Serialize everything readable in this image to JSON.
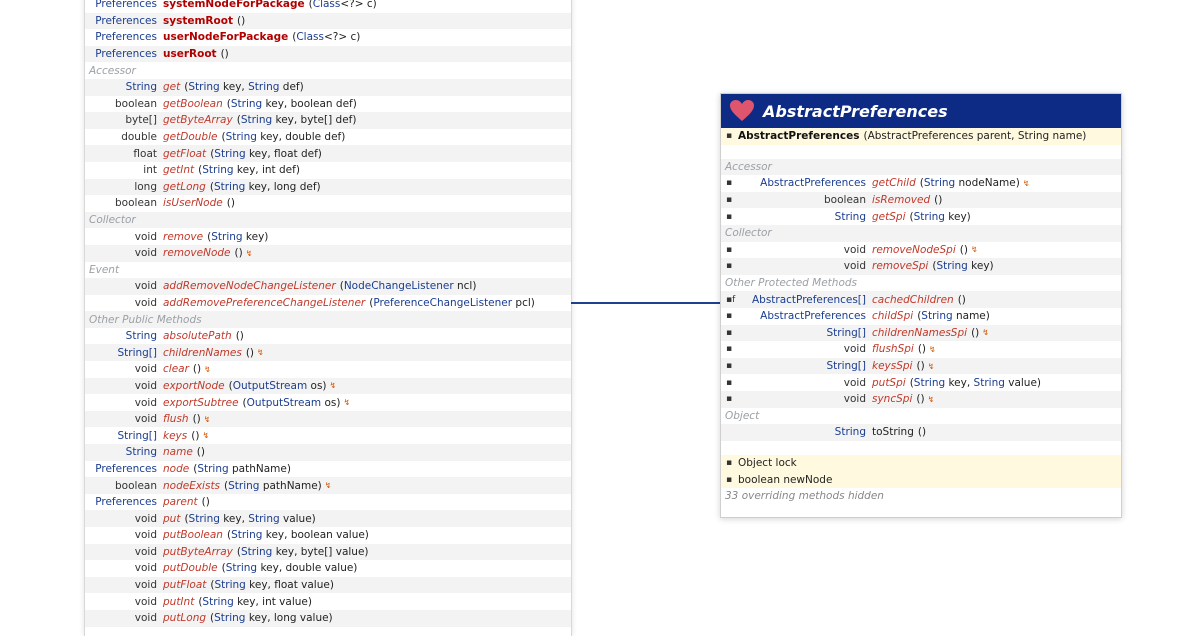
{
  "left_rows": [
    {
      "type": "Preferences",
      "name": "systemNodeForPackage",
      "style": "static",
      "params": [
        [
          "t",
          "Class"
        ],
        [
          "p",
          "<?> c)"
        ]
      ],
      "open": "("
    },
    {
      "type": "Preferences",
      "name": "systemRoot",
      "style": "static",
      "params": [
        [
          "p",
          "()"
        ]
      ]
    },
    {
      "type": "Preferences",
      "name": "userNodeForPackage",
      "style": "static",
      "params": [
        [
          "t",
          "Class"
        ],
        [
          "p",
          "<?> c)"
        ]
      ],
      "open": "("
    },
    {
      "type": "Preferences",
      "name": "userRoot",
      "style": "static",
      "params": [
        [
          "p",
          "()"
        ]
      ]
    },
    {
      "cat": "Accessor"
    },
    {
      "type": "String",
      "name": "get",
      "params": [
        [
          "t",
          "String"
        ],
        [
          "p",
          "key, "
        ],
        [
          "t",
          "String"
        ],
        [
          "p",
          "def)"
        ]
      ],
      "open": "("
    },
    {
      "type": "boolean",
      "prim": true,
      "name": "getBoolean",
      "params": [
        [
          "t",
          "String"
        ],
        [
          "p",
          "key, boolean def)"
        ]
      ],
      "open": "("
    },
    {
      "type": "byte[]",
      "prim": true,
      "name": "getByteArray",
      "params": [
        [
          "t",
          "String"
        ],
        [
          "p",
          "key, byte[] def)"
        ]
      ],
      "open": "("
    },
    {
      "type": "double",
      "prim": true,
      "name": "getDouble",
      "params": [
        [
          "t",
          "String"
        ],
        [
          "p",
          "key, double def)"
        ]
      ],
      "open": "("
    },
    {
      "type": "float",
      "prim": true,
      "name": "getFloat",
      "params": [
        [
          "t",
          "String"
        ],
        [
          "p",
          "key, float def)"
        ]
      ],
      "open": "("
    },
    {
      "type": "int",
      "prim": true,
      "name": "getInt",
      "params": [
        [
          "t",
          "String"
        ],
        [
          "p",
          "key, int def)"
        ]
      ],
      "open": "("
    },
    {
      "type": "long",
      "prim": true,
      "name": "getLong",
      "params": [
        [
          "t",
          "String"
        ],
        [
          "p",
          "key, long def)"
        ]
      ],
      "open": "("
    },
    {
      "type": "boolean",
      "prim": true,
      "name": "isUserNode",
      "params": [
        [
          "p",
          "()"
        ]
      ]
    },
    {
      "cat": "Collector"
    },
    {
      "type": "void",
      "prim": true,
      "name": "remove",
      "params": [
        [
          "t",
          "String"
        ],
        [
          "p",
          "key)"
        ]
      ],
      "open": "("
    },
    {
      "type": "void",
      "prim": true,
      "name": "removeNode",
      "params": [
        [
          "p",
          "()"
        ]
      ],
      "ind": "↯"
    },
    {
      "cat": "Event"
    },
    {
      "type": "void",
      "prim": true,
      "name": "addRemoveNodeChangeListener",
      "params": [
        [
          "t",
          "NodeChangeListener"
        ],
        [
          "p",
          "ncl)"
        ]
      ],
      "open": "("
    },
    {
      "type": "void",
      "prim": true,
      "name": "addRemovePreferenceChangeListener",
      "params": [
        [
          "t",
          "PreferenceChangeListener"
        ],
        [
          "p",
          "pcl)"
        ]
      ],
      "open": "("
    },
    {
      "cat": "Other Public Methods"
    },
    {
      "type": "String",
      "name": "absolutePath",
      "params": [
        [
          "p",
          "()"
        ]
      ]
    },
    {
      "type": "String[]",
      "name": "childrenNames",
      "params": [
        [
          "p",
          "()"
        ]
      ],
      "ind": "↯"
    },
    {
      "type": "void",
      "prim": true,
      "name": "clear",
      "params": [
        [
          "p",
          "()"
        ]
      ],
      "ind": "↯"
    },
    {
      "type": "void",
      "prim": true,
      "name": "exportNode",
      "params": [
        [
          "t",
          "OutputStream"
        ],
        [
          "p",
          "os)"
        ]
      ],
      "open": "(",
      "ind": "↯"
    },
    {
      "type": "void",
      "prim": true,
      "name": "exportSubtree",
      "params": [
        [
          "t",
          "OutputStream"
        ],
        [
          "p",
          "os)"
        ]
      ],
      "open": "(",
      "ind": "↯"
    },
    {
      "type": "void",
      "prim": true,
      "name": "flush",
      "params": [
        [
          "p",
          "()"
        ]
      ],
      "ind": "↯"
    },
    {
      "type": "String[]",
      "name": "keys",
      "params": [
        [
          "p",
          "()"
        ]
      ],
      "ind": "↯"
    },
    {
      "type": "String",
      "name": "name",
      "params": [
        [
          "p",
          "()"
        ]
      ]
    },
    {
      "type": "Preferences",
      "name": "node",
      "params": [
        [
          "t",
          "String"
        ],
        [
          "p",
          "pathName)"
        ]
      ],
      "open": "("
    },
    {
      "type": "boolean",
      "prim": true,
      "name": "nodeExists",
      "params": [
        [
          "t",
          "String"
        ],
        [
          "p",
          "pathName)"
        ]
      ],
      "open": "(",
      "ind": "↯"
    },
    {
      "type": "Preferences",
      "name": "parent",
      "params": [
        [
          "p",
          "()"
        ]
      ]
    },
    {
      "type": "void",
      "prim": true,
      "name": "put",
      "params": [
        [
          "t",
          "String"
        ],
        [
          "p",
          "key, "
        ],
        [
          "t",
          "String"
        ],
        [
          "p",
          "value)"
        ]
      ],
      "open": "("
    },
    {
      "type": "void",
      "prim": true,
      "name": "putBoolean",
      "params": [
        [
          "t",
          "String"
        ],
        [
          "p",
          "key, boolean value)"
        ]
      ],
      "open": "("
    },
    {
      "type": "void",
      "prim": true,
      "name": "putByteArray",
      "params": [
        [
          "t",
          "String"
        ],
        [
          "p",
          "key, byte[] value)"
        ]
      ],
      "open": "("
    },
    {
      "type": "void",
      "prim": true,
      "name": "putDouble",
      "params": [
        [
          "t",
          "String"
        ],
        [
          "p",
          "key, double value)"
        ]
      ],
      "open": "("
    },
    {
      "type": "void",
      "prim": true,
      "name": "putFloat",
      "params": [
        [
          "t",
          "String"
        ],
        [
          "p",
          "key, float value)"
        ]
      ],
      "open": "("
    },
    {
      "type": "void",
      "prim": true,
      "name": "putInt",
      "params": [
        [
          "t",
          "String"
        ],
        [
          "p",
          "key, int value)"
        ]
      ],
      "open": "("
    },
    {
      "type": "void",
      "prim": true,
      "name": "putLong",
      "params": [
        [
          "t",
          "String"
        ],
        [
          "p",
          "key, long value)"
        ]
      ],
      "open": "("
    }
  ],
  "right": {
    "title": "AbstractPreferences",
    "ctor": {
      "name": "AbstractPreferences",
      "params": "(AbstractPreferences parent, String name)"
    },
    "rows": [
      {
        "spacer": true
      },
      {
        "cat": "Accessor"
      },
      {
        "vis": "▪",
        "type": "AbstractPreferences",
        "name": "getChild",
        "params": [
          [
            "t",
            "String"
          ],
          [
            "p",
            "nodeName)"
          ]
        ],
        "open": "(",
        "ind": "↯"
      },
      {
        "vis": "▪",
        "type": "boolean",
        "prim": true,
        "name": "isRemoved",
        "params": [
          [
            "p",
            "()"
          ]
        ]
      },
      {
        "vis": "▪",
        "type": "String",
        "name": "getSpi",
        "params": [
          [
            "t",
            "String"
          ],
          [
            "p",
            "key)"
          ]
        ],
        "open": "("
      },
      {
        "cat": "Collector"
      },
      {
        "vis": "▪",
        "type": "void",
        "prim": true,
        "name": "removeNodeSpi",
        "params": [
          [
            "p",
            "()"
          ]
        ],
        "ind": "↯"
      },
      {
        "vis": "▪",
        "type": "void",
        "prim": true,
        "name": "removeSpi",
        "params": [
          [
            "t",
            "String"
          ],
          [
            "p",
            "key)"
          ]
        ],
        "open": "("
      },
      {
        "cat": "Other Protected Methods"
      },
      {
        "vis": "▪f",
        "type": "AbstractPreferences[]",
        "name": "cachedChildren",
        "params": [
          [
            "p",
            "()"
          ]
        ]
      },
      {
        "vis": "▪",
        "type": "AbstractPreferences",
        "name": "childSpi",
        "params": [
          [
            "t",
            "String"
          ],
          [
            "p",
            "name)"
          ]
        ],
        "open": "("
      },
      {
        "vis": "▪",
        "type": "String[]",
        "name": "childrenNamesSpi",
        "params": [
          [
            "p",
            "()"
          ]
        ],
        "ind": "↯"
      },
      {
        "vis": "▪",
        "type": "void",
        "prim": true,
        "name": "flushSpi",
        "params": [
          [
            "p",
            "()"
          ]
        ],
        "ind": "↯"
      },
      {
        "vis": "▪",
        "type": "String[]",
        "name": "keysSpi",
        "params": [
          [
            "p",
            "()"
          ]
        ],
        "ind": "↯"
      },
      {
        "vis": "▪",
        "type": "void",
        "prim": true,
        "name": "putSpi",
        "params": [
          [
            "t",
            "String"
          ],
          [
            "p",
            "key, "
          ],
          [
            "t",
            "String"
          ],
          [
            "p",
            "value)"
          ]
        ],
        "open": "("
      },
      {
        "vis": "▪",
        "type": "void",
        "prim": true,
        "name": "syncSpi",
        "params": [
          [
            "p",
            "()"
          ]
        ],
        "ind": "↯"
      },
      {
        "cat": "Object"
      },
      {
        "type": "String",
        "name": "toString",
        "plain": true,
        "params": [
          [
            "p",
            "()"
          ]
        ]
      },
      {
        "spacer": true
      }
    ],
    "fields": [
      {
        "vis": "▪",
        "text": "Object lock"
      },
      {
        "vis": "▪",
        "text": "boolean newNode"
      }
    ],
    "footer": "33 overriding methods hidden"
  },
  "colors": {
    "header": "#0d2a84",
    "connector": "#1f3f8f",
    "method": "#c0392b",
    "type": "#1a3d8f",
    "heart": "#e0556e"
  },
  "icons": [
    "heart-icon",
    "visibility-icon",
    "exception-indicator-icon"
  ]
}
